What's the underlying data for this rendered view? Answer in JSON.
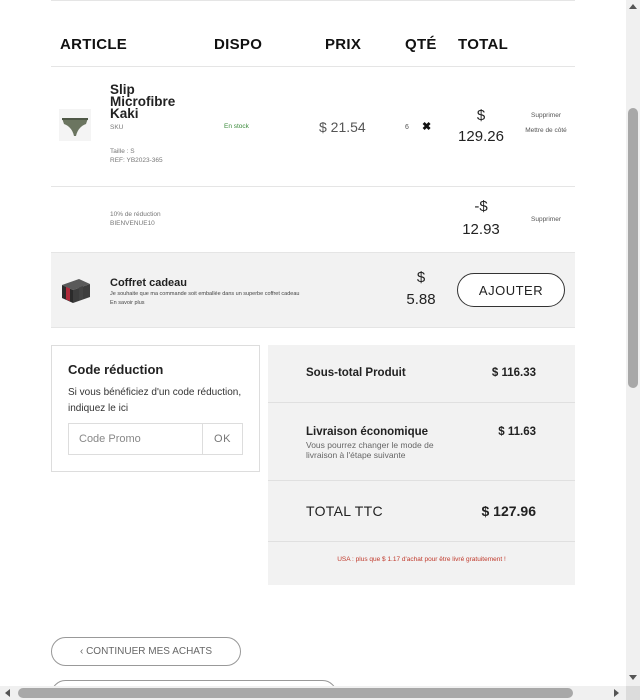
{
  "table": {
    "headers": {
      "article": "ARTICLE",
      "dispo": "DISPO",
      "prix": "PRIX",
      "qte": "QTÉ",
      "total": "TOTAL"
    },
    "item": {
      "name": "Slip Microfibre Kaki",
      "sku": "SKU",
      "size": "Taille : S",
      "ref": "REF: YB2023-365",
      "availability": "En stock",
      "price": "$ 21.54",
      "qty": "6",
      "qty_remove_glyph": "✖",
      "total_currency": "$",
      "total_amount": "129.26",
      "remove": "Supprimer",
      "save_for_later": "Mettre de côté",
      "thumb_color": "#6b7560"
    },
    "discount": {
      "label": "10% de réduction",
      "code": "BIENVENUE10",
      "total_currency": "-$",
      "total_amount": "12.93",
      "remove": "Supprimer"
    },
    "gift": {
      "title": "Coffret cadeau",
      "description": "Je souhaite que ma commande soit emballée dans un superbe coffret cadeau",
      "more": "En savoir plus",
      "price_currency": "$",
      "price_amount": "5.88",
      "add_label": "AJOUTER"
    }
  },
  "promo": {
    "title": "Code réduction",
    "text": "Si vous bénéficiez d'un code réduction, indiquez le ici",
    "placeholder": "Code Promo",
    "ok_label": "OK"
  },
  "summary": {
    "subtotal_label": "Sous-total Produit",
    "subtotal_value": "$ 116.33",
    "shipping_label": "Livraison économique",
    "shipping_value": "$ 11.63",
    "shipping_note": "Vous pourrez changer le mode de livraison à l'étape suivante",
    "total_label": "TOTAL TTC",
    "total_value": "$ 127.96",
    "free_shipping_notice": "USA : plus que $ 1.17 d'achat pour être livré gratuitement !",
    "notice_color": "#c0392b"
  },
  "actions": {
    "continue_label": "‹  CONTINUER MES ACHATS"
  }
}
